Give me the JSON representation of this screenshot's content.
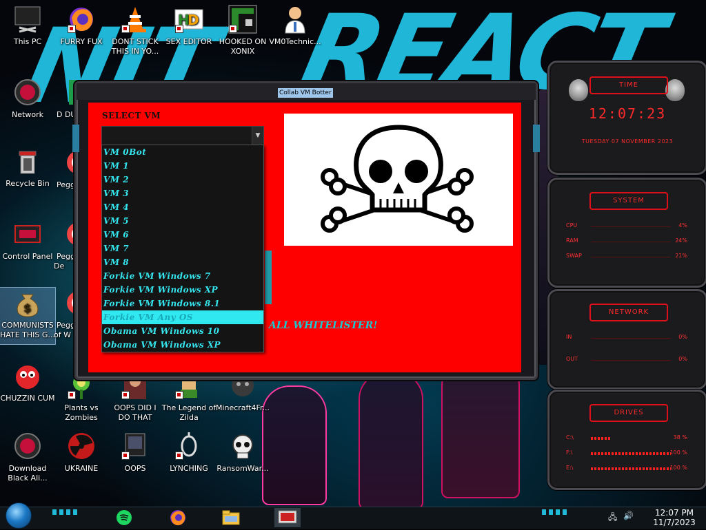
{
  "desktop": {
    "icons": [
      {
        "label": "This PC",
        "name": "this-pc"
      },
      {
        "label": "FURRY FUX",
        "name": "firefox-shortcut"
      },
      {
        "label": "DONT STICK THIS IN YO...",
        "name": "vlc-shortcut"
      },
      {
        "label": "SEX EDITOR",
        "name": "hxd-shortcut"
      },
      {
        "label": "HOOKED ON XONIX",
        "name": "xonix-shortcut"
      },
      {
        "label": "VM0Technic...",
        "name": "vm0technic-shortcut"
      },
      {
        "label": "Network",
        "name": "network"
      },
      {
        "label": "Recycle Bin",
        "name": "recycle-bin"
      },
      {
        "label": "Control Panel",
        "name": "control-panel"
      },
      {
        "label": "COMMUNISTS HATE THIS G...",
        "name": "communists-shortcut"
      },
      {
        "label": "CHUZZIN CUM",
        "name": "chuzzle-shortcut"
      },
      {
        "label": "Download Black Ali...",
        "name": "download-black-alien"
      },
      {
        "label": "Plants vs Zombies",
        "name": "pvz-shortcut"
      },
      {
        "label": "UKRAINE",
        "name": "ukraine-shortcut"
      },
      {
        "label": "OOPS DID I DO THAT",
        "name": "oops-did-i-shortcut"
      },
      {
        "label": "OOPS",
        "name": "oops-shortcut"
      },
      {
        "label": "The Legend of Zilda",
        "name": "zilda-shortcut"
      },
      {
        "label": "LYNCHING",
        "name": "lynching-shortcut"
      },
      {
        "label": "Minecraft4Fr...",
        "name": "minecraft-shortcut"
      },
      {
        "label": "RansomWar...",
        "name": "ransomware-shortcut"
      },
      {
        "label": "Peggl",
        "name": "peggle-1"
      },
      {
        "label": "Pegg De",
        "name": "peggle-2"
      },
      {
        "label": "Pegg of W",
        "name": "peggle-3"
      },
      {
        "label": "D DU",
        "name": "partial-icon"
      }
    ]
  },
  "app": {
    "title": "Collab VM Botter",
    "select_label": "SELECT VM",
    "selected_value": "",
    "options": [
      "VM 0Bot",
      "VM 1",
      "VM 2",
      "VM 3",
      "VM 4",
      "VM 5",
      "VM 6",
      "VM 7",
      "VM 8",
      "Forkie VM Windows 7",
      "Forkie VM Windows XP",
      "Forkie VM Windows 8.1",
      "Forkie VM Any OS",
      "Obama VM Windows 10",
      "Obama VM Windows XP"
    ],
    "highlighted_index": 12,
    "whitelister_text": "ALL WHITELISTER!",
    "preview_icon": "skull-crossbones-icon"
  },
  "widgets": {
    "time": {
      "header": "TIME",
      "clock": "12:07:23",
      "date": "TUESDAY 07 NOVEMBER 2023"
    },
    "system": {
      "header": "SYSTEM",
      "rows": [
        {
          "label": "CPU",
          "value": "4%"
        },
        {
          "label": "RAM",
          "value": "24%"
        },
        {
          "label": "SWAP",
          "value": "21%"
        }
      ]
    },
    "network": {
      "header": "NETWORK",
      "rows": [
        {
          "label": "IN",
          "value": "0%"
        },
        {
          "label": "OUT",
          "value": "0%"
        }
      ]
    },
    "drives": {
      "header": "DRIVES",
      "rows": [
        {
          "label": "C:\\",
          "value": "38 %"
        },
        {
          "label": "F:\\",
          "value": "100 %"
        },
        {
          "label": "E:\\",
          "value": "100 %"
        }
      ]
    }
  },
  "taskbar": {
    "time": "12:07 PM",
    "date": "11/7/2023"
  },
  "colors": {
    "app_background": "#ff0000",
    "list_text": "#35e6ef",
    "widget_accent": "#ff2a2a"
  }
}
